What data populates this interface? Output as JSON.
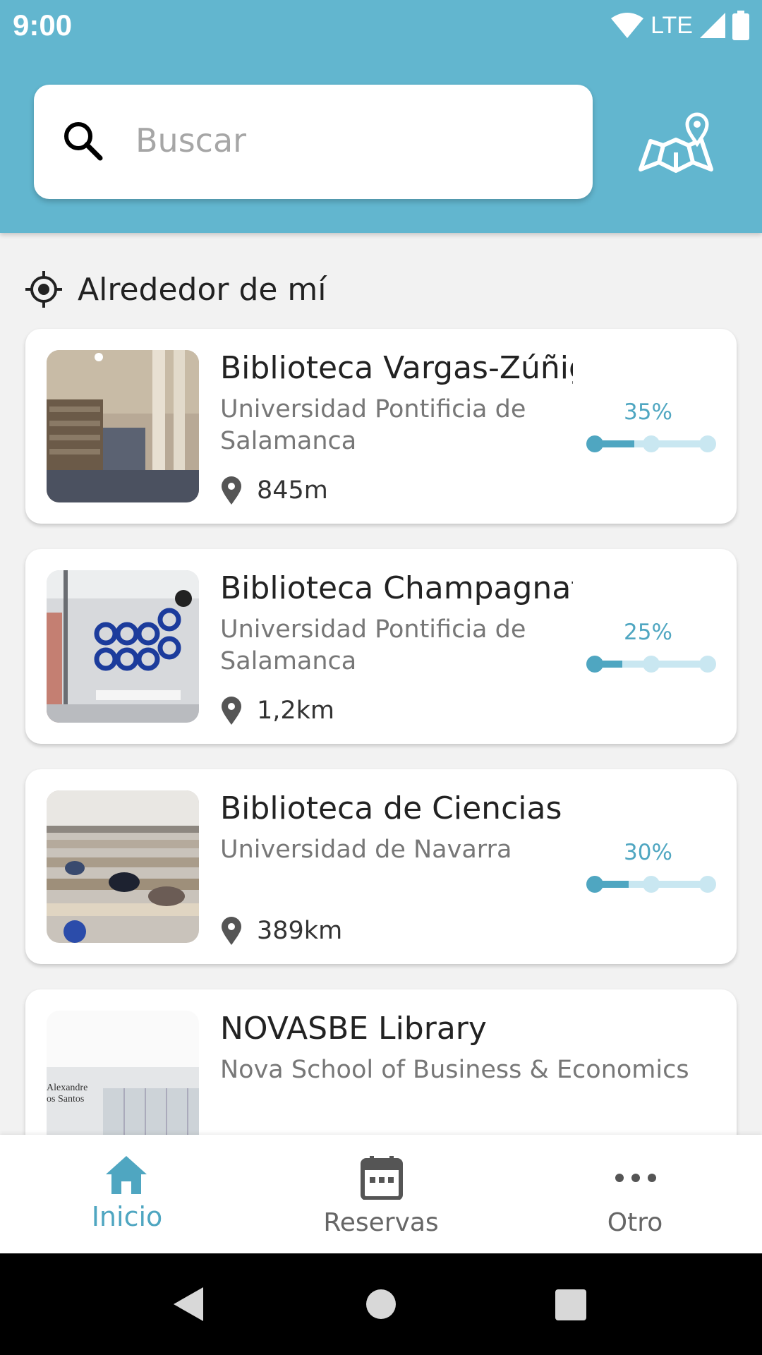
{
  "status_bar": {
    "time": "9:00",
    "network": "LTE"
  },
  "search": {
    "placeholder": "Buscar"
  },
  "section": {
    "title": "Alrededor de mí"
  },
  "libraries": [
    {
      "name": "Biblioteca Vargas-Zúñiga",
      "institution": "Universidad Pontificia de Salamanca",
      "distance": "845m",
      "occupancy_label": "35%",
      "occupancy": 0.35
    },
    {
      "name": "Biblioteca Champagnat",
      "institution": "Universidad Pontificia de Salamanca",
      "distance": "1,2km",
      "occupancy_label": "25%",
      "occupancy": 0.25
    },
    {
      "name": "Biblioteca de Ciencias",
      "institution": "Universidad de Navarra",
      "distance": "389km",
      "occupancy_label": "30%",
      "occupancy": 0.3
    },
    {
      "name": "NOVASBE Library",
      "institution": "Nova School of Business & Economics",
      "thumb_text": "Alexandre\nos Santos"
    }
  ],
  "bottom_nav": [
    {
      "label": "Inicio",
      "icon": "home-icon",
      "active": true
    },
    {
      "label": "Reservas",
      "icon": "calendar-icon",
      "active": false
    },
    {
      "label": "Otro",
      "icon": "more-icon",
      "active": false
    }
  ],
  "colors": {
    "primary": "#62b6cf",
    "accent": "#4fa6c1",
    "track": "#c9e7f1"
  }
}
